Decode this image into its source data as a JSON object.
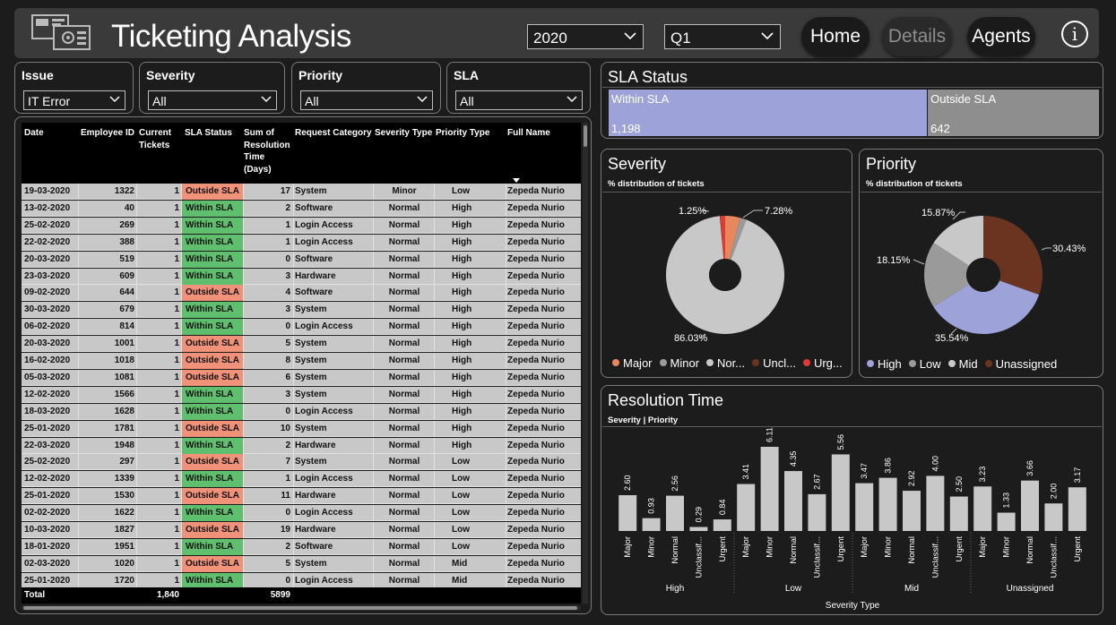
{
  "header": {
    "title": "Ticketing Analysis",
    "year_select": "2020",
    "quarter_select": "Q1",
    "nav": [
      {
        "label": "Home",
        "active": false
      },
      {
        "label": "Details",
        "active": true
      },
      {
        "label": "Agents",
        "active": false
      }
    ],
    "info_icon": "i"
  },
  "slicers": [
    {
      "label": "Issue",
      "value": "IT Error"
    },
    {
      "label": "Severity",
      "value": "All"
    },
    {
      "label": "Priority",
      "value": "All"
    },
    {
      "label": "SLA",
      "value": "All"
    }
  ],
  "table": {
    "columns": [
      "Date",
      "Employee ID",
      "Current Tickets",
      "SLA Status",
      "Sum of Resolution Time (Days)",
      "Request Category",
      "Severity Type",
      "Priority Type",
      "Full Name"
    ],
    "rows": [
      [
        "19-03-2020",
        "1322",
        "1",
        "Outside SLA",
        "17",
        "System",
        "Minor",
        "Low",
        "Zepeda Nurio"
      ],
      [
        "13-02-2020",
        "40",
        "1",
        "Within SLA",
        "2",
        "Software",
        "Normal",
        "High",
        "Zepeda Nurio"
      ],
      [
        "25-02-2020",
        "269",
        "1",
        "Within SLA",
        "1",
        "Login Access",
        "Normal",
        "High",
        "Zepeda Nurio"
      ],
      [
        "22-02-2020",
        "388",
        "1",
        "Within SLA",
        "1",
        "Login Access",
        "Normal",
        "High",
        "Zepeda Nurio"
      ],
      [
        "20-03-2020",
        "519",
        "1",
        "Within SLA",
        "0",
        "Software",
        "Normal",
        "High",
        "Zepeda Nurio"
      ],
      [
        "23-03-2020",
        "609",
        "1",
        "Within SLA",
        "3",
        "Hardware",
        "Normal",
        "High",
        "Zepeda Nurio"
      ],
      [
        "09-02-2020",
        "644",
        "1",
        "Outside SLA",
        "4",
        "Software",
        "Normal",
        "High",
        "Zepeda Nurio"
      ],
      [
        "30-03-2020",
        "679",
        "1",
        "Within SLA",
        "3",
        "System",
        "Normal",
        "High",
        "Zepeda Nurio"
      ],
      [
        "06-02-2020",
        "814",
        "1",
        "Within SLA",
        "0",
        "Login Access",
        "Normal",
        "High",
        "Zepeda Nurio"
      ],
      [
        "20-03-2020",
        "1001",
        "1",
        "Outside SLA",
        "5",
        "System",
        "Normal",
        "High",
        "Zepeda Nurio"
      ],
      [
        "16-02-2020",
        "1018",
        "1",
        "Outside SLA",
        "8",
        "System",
        "Normal",
        "High",
        "Zepeda Nurio"
      ],
      [
        "05-03-2020",
        "1081",
        "1",
        "Outside SLA",
        "6",
        "System",
        "Normal",
        "High",
        "Zepeda Nurio"
      ],
      [
        "12-02-2020",
        "1566",
        "1",
        "Within SLA",
        "3",
        "System",
        "Normal",
        "High",
        "Zepeda Nurio"
      ],
      [
        "18-03-2020",
        "1628",
        "1",
        "Within SLA",
        "0",
        "Login Access",
        "Normal",
        "High",
        "Zepeda Nurio"
      ],
      [
        "25-01-2020",
        "1781",
        "1",
        "Outside SLA",
        "10",
        "System",
        "Normal",
        "High",
        "Zepeda Nurio"
      ],
      [
        "22-03-2020",
        "1948",
        "1",
        "Within SLA",
        "2",
        "Hardware",
        "Normal",
        "High",
        "Zepeda Nurio"
      ],
      [
        "25-02-2020",
        "297",
        "1",
        "Outside SLA",
        "7",
        "System",
        "Normal",
        "Low",
        "Zepeda Nurio"
      ],
      [
        "12-02-2020",
        "1339",
        "1",
        "Within SLA",
        "1",
        "Login Access",
        "Normal",
        "Low",
        "Zepeda Nurio"
      ],
      [
        "25-01-2020",
        "1530",
        "1",
        "Outside SLA",
        "11",
        "Hardware",
        "Normal",
        "Low",
        "Zepeda Nurio"
      ],
      [
        "02-02-2020",
        "1622",
        "1",
        "Within SLA",
        "0",
        "Login Access",
        "Normal",
        "Low",
        "Zepeda Nurio"
      ],
      [
        "10-03-2020",
        "1827",
        "1",
        "Outside SLA",
        "19",
        "Hardware",
        "Normal",
        "Low",
        "Zepeda Nurio"
      ],
      [
        "18-01-2020",
        "1951",
        "1",
        "Within SLA",
        "2",
        "Software",
        "Normal",
        "Low",
        "Zepeda Nurio"
      ],
      [
        "02-03-2020",
        "1020",
        "1",
        "Outside SLA",
        "5",
        "System",
        "Normal",
        "Mid",
        "Zepeda Nurio"
      ],
      [
        "25-01-2020",
        "1720",
        "1",
        "Within SLA",
        "0",
        "Login Access",
        "Normal",
        "Mid",
        "Zepeda Nurio"
      ]
    ],
    "total": {
      "label": "Total",
      "tickets": "1,840",
      "resolution": "5899"
    },
    "status_colors": {
      "Within SLA": "#5fbf6f",
      "Outside SLA": "#f0917a"
    }
  },
  "sla_status": {
    "title": "SLA Status",
    "segments": [
      {
        "label": "Within SLA",
        "value": 1198,
        "display": "1,198",
        "color": "#9da3d9"
      },
      {
        "label": "Outside SLA",
        "value": 642,
        "display": "642",
        "color": "#8e8e8e"
      }
    ]
  },
  "severity": {
    "title": "Severity",
    "subtitle": "% distribution of tickets",
    "slices": [
      {
        "label": "Major",
        "pct": 3.82,
        "color": "#e8875e"
      },
      {
        "label": "Minor",
        "pct": 1.59,
        "color": "#9a9a9a"
      },
      {
        "label": "Normal",
        "pct": 86.03,
        "display": "86.03%",
        "color": "#c8c8c8"
      },
      {
        "label": "Unclassified",
        "pct": 0.1,
        "color": "#6b3420"
      },
      {
        "label": "Urgent",
        "pct": 1.25,
        "display": "1.25%",
        "color": "#e03a32"
      }
    ],
    "callouts": [
      {
        "text": "7.28%"
      },
      {
        "text": "1.25%"
      },
      {
        "text": "86.03%"
      }
    ],
    "legend": [
      "Major",
      "Minor",
      "Nor...",
      "Uncl...",
      "Urg..."
    ]
  },
  "priority": {
    "title": "Priority",
    "subtitle": "% distribution of tickets",
    "slices": [
      {
        "label": "Unassigned",
        "pct": 30.43,
        "display": "30.43%",
        "color": "#6b3420"
      },
      {
        "label": "High",
        "pct": 35.54,
        "display": "35.54%",
        "color": "#9da3d9"
      },
      {
        "label": "Low",
        "pct": 18.15,
        "display": "18.15%",
        "color": "#9a9a9a"
      },
      {
        "label": "Mid",
        "pct": 15.87,
        "display": "15.87%",
        "color": "#c8c8c8"
      }
    ],
    "legend": [
      "High",
      "Low",
      "Mid",
      "Unassigned"
    ]
  },
  "chart_data": {
    "type": "bar",
    "title": "Resolution Time",
    "subtitle": "Severity | Priority",
    "xlabel": "Severity Type",
    "groups": [
      "High",
      "Low",
      "Mid",
      "Unassigned"
    ],
    "categories": [
      "Major",
      "Minor",
      "Normal",
      "Unclassif...",
      "Urgent"
    ],
    "series": [
      {
        "group": "High",
        "values": [
          2.6,
          0.93,
          2.56,
          0.29,
          0.84
        ]
      },
      {
        "group": "Low",
        "values": [
          3.41,
          6.11,
          4.35,
          2.67,
          5.56
        ]
      },
      {
        "group": "Mid",
        "values": [
          3.47,
          3.86,
          2.92,
          4.0,
          2.5
        ]
      },
      {
        "group": "Unassigned",
        "values": [
          3.23,
          1.33,
          3.66,
          2.0,
          3.17
        ]
      }
    ],
    "ylim": [
      0,
      6.5
    ],
    "grid": false,
    "bar_color": "#c8c8c8"
  }
}
